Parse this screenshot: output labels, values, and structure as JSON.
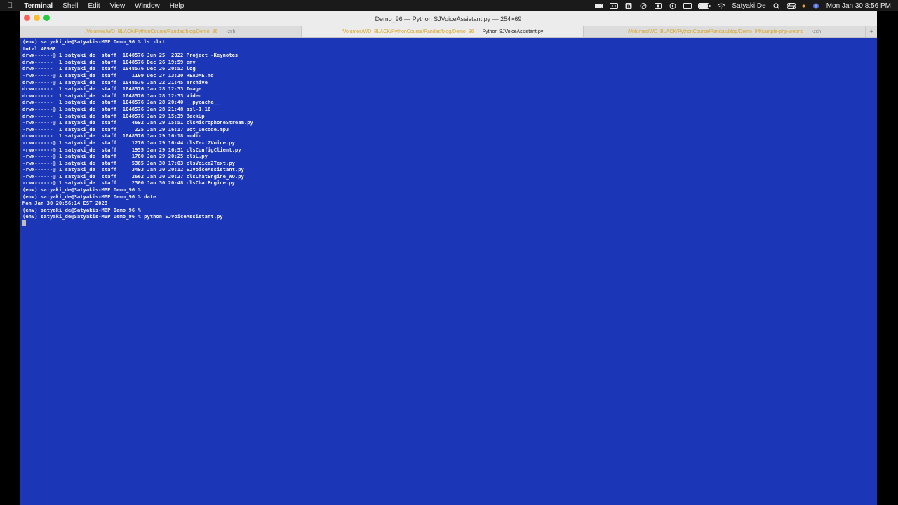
{
  "menubar": {
    "apple_icon": "apple-icon",
    "app_name": "Terminal",
    "menus": [
      "Shell",
      "Edit",
      "View",
      "Window",
      "Help"
    ],
    "user": "Satyaki De",
    "clock": "Mon Jan 30  8:56 PM"
  },
  "window": {
    "title": "Demo_96 — Python SJVoiceAssistant.py — 254×69",
    "tabs": [
      {
        "path": "/Volumes/WD_BLACK/PythonCourse/Pandas/blog/Demo_96",
        "label": "— -zsh",
        "active": false
      },
      {
        "path": "/Volumes/WD_BLACK/PythonCourse/Pandas/blog/Demo_96",
        "label": "— Python SJVoiceAssistant.py",
        "active": true
      },
      {
        "path": "/Volumes/WD_BLACK/PythonCourse/Pandas/blog/Demo_94/sample-php-webrtc",
        "label": "— -zsh",
        "active": false
      }
    ],
    "new_tab_label": "+"
  },
  "terminal": {
    "lines": [
      "(env) satyaki_de@Satyakis-MBP Demo_96 % ls -lrt",
      "total 40960",
      "drwx------@ 1 satyaki_de  staff  1048576 Jun 25  2022 Project -Keynotes",
      "drwx------  1 satyaki_de  staff  1048576 Dec 26 19:59 env",
      "drwx------  1 satyaki_de  staff  1048576 Dec 26 20:52 log",
      "-rwx------@ 1 satyaki_de  staff     1109 Dec 27 13:30 README.md",
      "drwx------@ 1 satyaki_de  staff  1048576 Jan 22 21:45 archive",
      "drwx------  1 satyaki_de  staff  1048576 Jan 28 12:33 Image",
      "drwx------  1 satyaki_de  staff  1048576 Jan 28 12:33 Video",
      "drwx------  1 satyaki_de  staff  1048576 Jan 28 20:40 __pycache__",
      "drwx------@ 1 satyaki_de  staff  1048576 Jan 28 21:48 ssl-1.16",
      "drwx------  1 satyaki_de  staff  1048576 Jan 29 15:39 BackUp",
      "-rwx------@ 1 satyaki_de  staff     4692 Jan 29 15:51 clsMicrophoneStream.py",
      "-rwx------  1 satyaki_de  staff      225 Jan 29 16:17 Bot_Decode.mp3",
      "drwx------  1 satyaki_de  staff  1048576 Jan 29 16:18 audio",
      "-rwx------@ 1 satyaki_de  staff     1276 Jan 29 16:44 clsText2Voice.py",
      "-rwx------@ 1 satyaki_de  staff     1955 Jan 29 16:51 clsConfigClient.py",
      "-rwx------@ 1 satyaki_de  staff     1780 Jan 29 20:25 clsL.py",
      "-rwx------@ 1 satyaki_de  staff     5385 Jan 30 17:03 clsVoice2Text.py",
      "-rwx------@ 1 satyaki_de  staff     3493 Jan 30 20:12 SJVoiceAssistant.py",
      "-rwx------@ 1 satyaki_de  staff     2662 Jan 30 20:27 clsChatEngine_WO.py",
      "-rwx------@ 1 satyaki_de  staff     2300 Jan 30 20:48 clsChatEngine.py",
      "(env) satyaki_de@Satyakis-MBP Demo_96 %",
      "(env) satyaki_de@Satyakis-MBP Demo_96 % date",
      "Mon Jan 30 20:56:14 EST 2023",
      "(env) satyaki_de@Satyakis-MBP Demo_96 %",
      "(env) satyaki_de@Satyakis-MBP Demo_96 % python SJVoiceAssistant.py"
    ]
  },
  "colors": {
    "terminal_bg": "#1c36b8",
    "terminal_fg": "#f2f2f2",
    "menubar_bg": "#1a1a1a"
  }
}
